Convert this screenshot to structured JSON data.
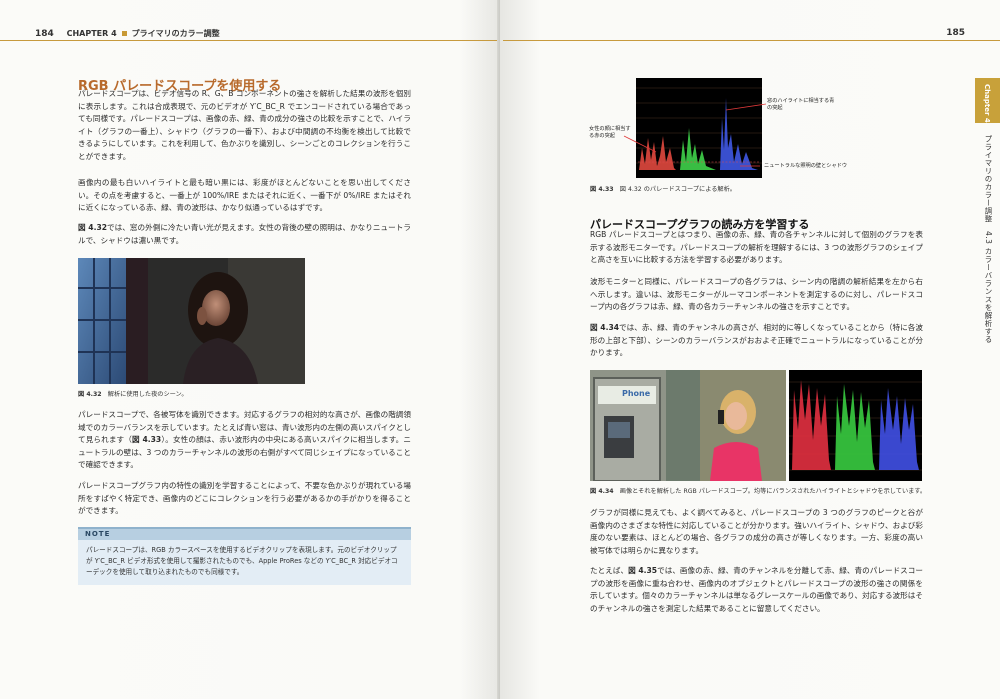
{
  "left_page": {
    "page_number": "184",
    "chapter": "CHAPTER 4",
    "chapter_title": "プライマリのカラー調整",
    "heading": "RGB パレードスコープを使用する",
    "para1": "パレードスコープは、ビデオ信号の R、G、B コンポーネントの強さを解析した結果の波形を個別に表示します。これは合成表現で、元のビデオが Y′C_BC_R でエンコードされている場合であっても同様です。パレードスコープは、画像の赤、緑、青の成分の強さの比較を示すことで、ハイライト（グラフの一番上）、シャドウ（グラフの一番下）、および中間調の不均衡を検出して比較できるようにしています。これを利用して、色かぶりを識別し、シーンごとのコレクションを行うことができます。",
    "para2": "画像内の最も白いハイライトと最も暗い黒には、彩度がほとんどないことを思い出してください。その点を考慮すると、一番上が 100%/IRE またはそれに近く、一番下が 0%/IRE またはそれに近くになっている赤、緑、青の波形は、かなり似通っているはずです。",
    "para3_ref": "図 4.32",
    "para3": "では、窓の外側に冷たい青い光が見えます。女性の背後の壁の照明は、かなりニュートラルで、シャドウは濃い黒です。",
    "fig432_num": "図 4.32",
    "fig432_caption": "解析に使用した夜のシーン。",
    "para4": "パレードスコープで、各被写体を識別できます。対応するグラフの相対的な高さが、画像の階調領域でのカラーバランスを示しています。たとえば青い窓は、青い波形内の左側の高いスパイクとして見られます（",
    "para4_ref": "図 4.33",
    "para4b": "）。女性の顔は、赤い波形内の中央にある高いスパイクに相当します。ニュートラルの壁は、3 つのカラーチャンネルの波形の右側がすべて同じシェイプになっていることで確認できます。",
    "para5": "パレードスコープグラフ内の特性の識別を学習することによって、不要な色かぶりが現れている場所をすばやく特定でき、画像内のどこにコレクションを行う必要があるかの手がかりを得ることができます。",
    "note_heading": "NOTE",
    "note_text": "パレードスコープは、RGB カラースペースを使用するビデオクリップを表現します。元のビデオクリップが Y′C_BC_R ビデオ形式を使用して撮影されたものでも、Apple ProRes などの Y′C_BC_R 対応ビデオコーデックを使用して取り込まれたものでも同様です。"
  },
  "right_page": {
    "page_number": "185",
    "tab_label": "Chapter 4",
    "side_text": "プライマリのカラー調整　4.3 カラーバランスを解析する",
    "fig433_num": "図 4.33",
    "fig433_caption": "図 4.32 のパレードスコープによる解析。",
    "anno_highlight": "窓のハイライトに相当する青の突起",
    "anno_face": "女性の顔に相当する赤の突起",
    "anno_neutral": "ニュートラルな照明の壁とシャドウ",
    "heading": "パレードスコープグラフの読み方を学習する",
    "para1": "RGB パレードスコープとはつまり、画像の赤、緑、青の各チャンネルに対して個別のグラフを表示する波形モニターです。パレードスコープの解析を理解するには、3 つの波形グラフのシェイプと高さを互いに比較する方法を学習する必要があります。",
    "para2": "波形モニターと同様に、パレードスコープの各グラフは、シーン内の階調の解析結果を左から右へ示します。違いは、波形モニターがルーマコンポーネントを測定するのに対し、パレードスコープ内の各グラフは赤、緑、青の各カラーチャンネルの強さを示すことです。",
    "para3_ref": "図 4.34",
    "para3": "では、赤、緑、青のチャンネルの高さが、相対的に等しくなっていることから（特に各波形の上部と下部）、シーンのカラーバランスがおおよそ正確でニュートラルになっていることが分かります。",
    "phone_sign": "Phone",
    "fig434_num": "図 4.34",
    "fig434_caption": "画像とそれを解析した RGB パレードスコープ。均等にバランスされたハイライトとシャドウを示しています。",
    "para4": "グラフが同様に見えても、よく調べてみると、パレードスコープの 3 つのグラフのピークと谷が画像内のさまざまな特性に対応していることが分かります。強いハイライト、シャドウ、および彩度のない要素は、ほとんどの場合、各グラフの成分の高さが等しくなります。一方、彩度の高い被写体では明らかに異なります。",
    "para5_pre": "たとえば、",
    "para5_ref": "図 4.35",
    "para5": "では、画像の赤、緑、青のチャンネルを分離して赤、緑、青のパレードスコープの波形を画像に重ね合わせ、画像内のオブジェクトとパレードスコープの波形の強さの関係を示しています。個々のカラーチャンネルは単なるグレースケールの画像であり、対応する波形はそのチャンネルの強さを測定した結果であることに留意してください。"
  }
}
